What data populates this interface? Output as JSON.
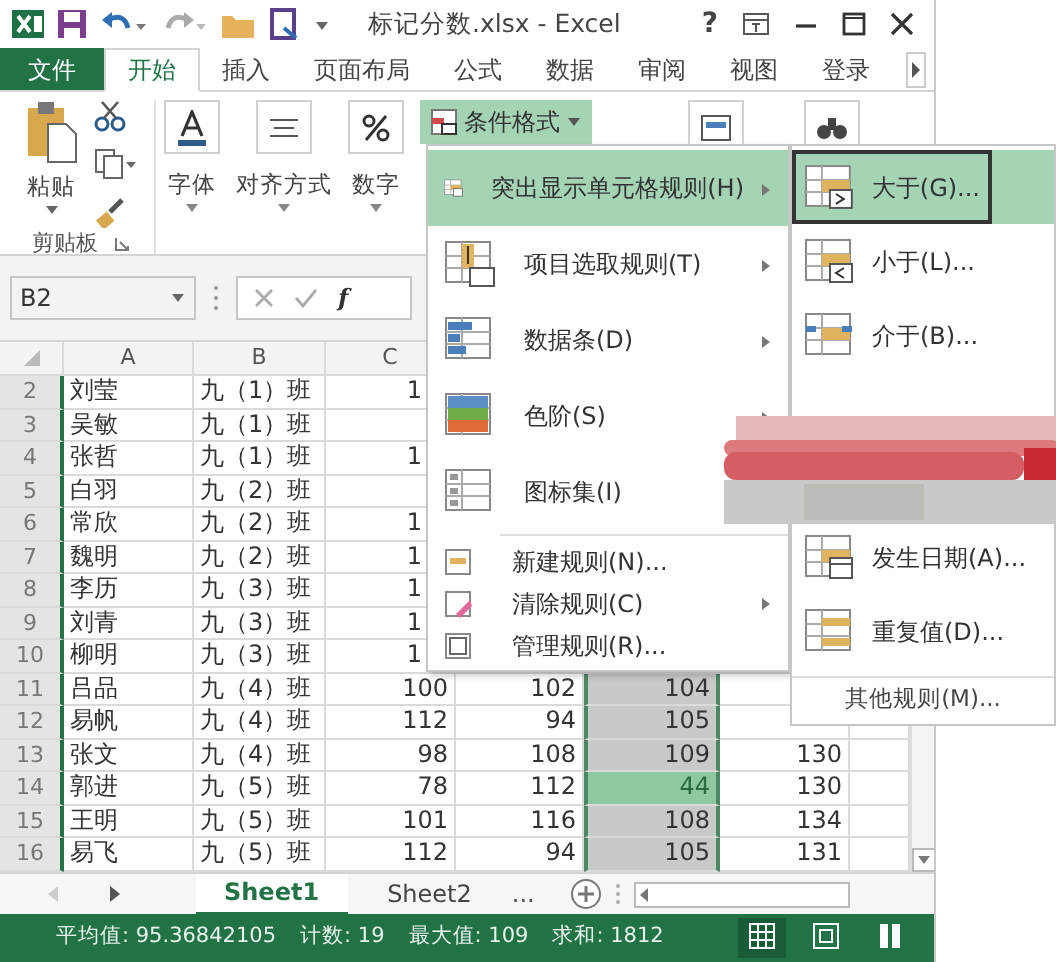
{
  "window": {
    "title": "标记分数.xlsx - Excel",
    "help": "?"
  },
  "tabs": [
    {
      "label": "文件",
      "kind": "file",
      "selected": false
    },
    {
      "label": "开始",
      "kind": "tab",
      "selected": true
    },
    {
      "label": "插入",
      "kind": "tab",
      "selected": false
    },
    {
      "label": "页面布局",
      "kind": "tab",
      "selected": false
    },
    {
      "label": "公式",
      "kind": "tab",
      "selected": false
    },
    {
      "label": "数据",
      "kind": "tab",
      "selected": false
    },
    {
      "label": "审阅",
      "kind": "tab",
      "selected": false
    },
    {
      "label": "视图",
      "kind": "tab",
      "selected": false
    },
    {
      "label": "登录",
      "kind": "tab",
      "selected": false
    }
  ],
  "ribbon": {
    "paste": "粘贴",
    "clipboard_group": "剪贴板",
    "font": "字体",
    "alignment": "对齐方式",
    "number": "数字",
    "conditional_format": {
      "label": "条件格式",
      "pressed": true
    }
  },
  "formula_bar": {
    "name_box": "B2",
    "function_label": "f"
  },
  "grid": {
    "columns": [
      "A",
      "B",
      "C"
    ],
    "rows": [
      {
        "row": "2",
        "cells": [
          "刘莹",
          "九（1）班",
          "1"
        ]
      },
      {
        "row": "3",
        "cells": [
          "吴敏",
          "九（1）班"
        ]
      },
      {
        "row": "4",
        "cells": [
          "张哲",
          "九（1）班",
          "1"
        ]
      },
      {
        "row": "5",
        "cells": [
          "白羽",
          "九（2）班"
        ]
      },
      {
        "row": "6",
        "cells": [
          "常欣",
          "九（2）班",
          "1"
        ]
      },
      {
        "row": "7",
        "cells": [
          "魏明",
          "九（2）班",
          "1"
        ]
      },
      {
        "row": "8",
        "cells": [
          "李历",
          "九（3）班",
          "1"
        ]
      },
      {
        "row": "9",
        "cells": [
          "刘青",
          "九（3）班",
          "1"
        ]
      },
      {
        "row": "10",
        "cells": [
          "柳明",
          "九（3）班",
          "1"
        ]
      },
      {
        "row": "11",
        "cells": [
          "吕品",
          "九（4）班",
          "100",
          "102",
          "104"
        ],
        "selected": true,
        "highlighted": false
      },
      {
        "row": "12",
        "cells": [
          "易帆",
          "九（4）班",
          "112",
          "94",
          "105"
        ],
        "selected": true,
        "highlighted": false
      },
      {
        "row": "13",
        "cells": [
          "张文",
          "九（4）班",
          "98",
          "108",
          "109",
          "130"
        ],
        "selected": true,
        "highlighted": false
      },
      {
        "row": "14",
        "cells": [
          "郭进",
          "九（5）班",
          "78",
          "112",
          "44",
          "130"
        ],
        "selected": true,
        "highlighted": true
      },
      {
        "row": "15",
        "cells": [
          "王明",
          "九（5）班",
          "101",
          "116",
          "108",
          "134"
        ],
        "selected": true,
        "highlighted": false
      },
      {
        "row": "16",
        "cells": [
          "易飞",
          "九（5）班",
          "112",
          "94",
          "105",
          "131"
        ],
        "selected": true,
        "highlighted": false
      }
    ]
  },
  "sheet_tabs": [
    {
      "label": "Sheet1",
      "selected": true
    },
    {
      "label": "Sheet2",
      "selected": false
    }
  ],
  "more_sheets": "...",
  "status_bar": {
    "items": [
      "平均值: 95.36842105",
      "计数: 19",
      "最大值: 109",
      "求和: 1812"
    ],
    "view_buttons": [
      {
        "selected": true
      },
      {
        "selected": false
      },
      {
        "selected": false
      }
    ]
  },
  "menu": {
    "items": [
      {
        "label": "突出显示单元格规则(H)",
        "kind": "large",
        "submenu": true,
        "selected": true
      },
      {
        "label": "项目选取规则(T)",
        "kind": "large",
        "submenu": true,
        "selected": false
      },
      {
        "label": "数据条(D)",
        "kind": "large",
        "submenu": true,
        "selected": false
      },
      {
        "label": "色阶(S)",
        "kind": "large",
        "submenu": true,
        "selected": false
      },
      {
        "label": "图标集(I)",
        "kind": "large",
        "submenu": false,
        "selected": false
      },
      {
        "label": "新建规则(N)...",
        "kind": "small",
        "submenu": false,
        "selected": false
      },
      {
        "label": "清除规则(C)",
        "kind": "small",
        "submenu": true,
        "selected": false
      },
      {
        "label": "管理规则(R)...",
        "kind": "small",
        "submenu": false,
        "selected": false
      }
    ]
  },
  "submenu": {
    "items": [
      {
        "label": "大于(G)...",
        "kind": "rule",
        "selected": true
      },
      {
        "label": "小于(L)...",
        "kind": "rule",
        "selected": false
      },
      {
        "label": "介于(B)...",
        "kind": "rule",
        "selected": false
      },
      {
        "kind": "redacted"
      },
      {
        "label": "发生日期(A)...",
        "kind": "rule",
        "selected": false
      },
      {
        "label": "重复值(D)...",
        "kind": "rule",
        "selected": false
      },
      {
        "label": "其他规则(M)...",
        "kind": "more",
        "selected": false
      }
    ]
  }
}
